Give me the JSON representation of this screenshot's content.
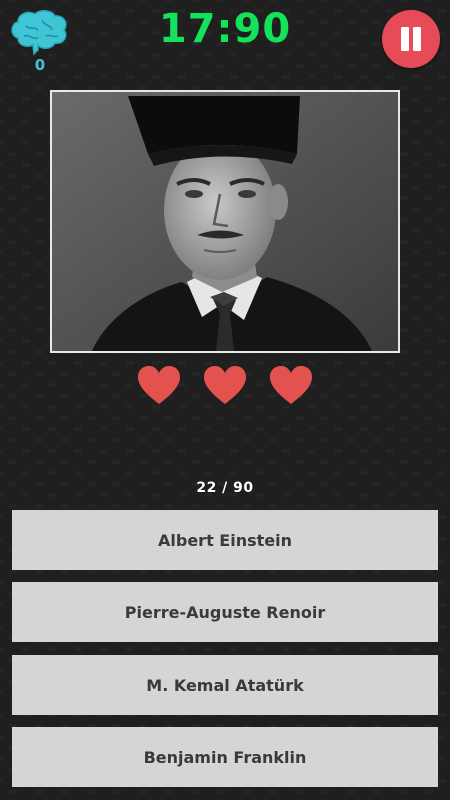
{
  "hud": {
    "score": "0",
    "timer": "17:90",
    "pause_icon": "pause-icon",
    "brain_icon": "brain-icon",
    "accent_colors": {
      "timer": "#14e25a",
      "score": "#3ec6d6",
      "pause": "#e64b57",
      "heart": "#e3524f"
    }
  },
  "question": {
    "image": "black-and-white portrait of a man in a fur kalpak hat",
    "progress": "22 / 90",
    "lives_remaining": 3
  },
  "answers": [
    {
      "label": "Albert Einstein"
    },
    {
      "label": "Pierre-Auguste Renoir"
    },
    {
      "label": "M. Kemal Atatürk"
    },
    {
      "label": "Benjamin Franklin"
    }
  ]
}
